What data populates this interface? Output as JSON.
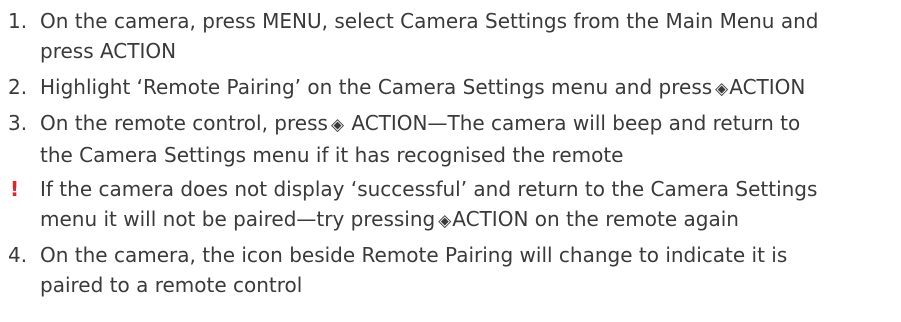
{
  "steps": [
    {
      "marker": "1.",
      "line1": "On the camera, press MENU, select Camera Settings from the Main Menu and",
      "line2": "press ACTION"
    },
    {
      "marker": "2.",
      "line1_pre": "Highlight ‘Remote Pairing’ on the Camera Settings menu and press",
      "line1_post": "ACTION"
    },
    {
      "marker": "3.",
      "line1_pre": "On the remote control, press",
      "line1_post": " ACTION—The camera will beep and return to",
      "line2": "the Camera Settings menu if it has recognised the remote"
    },
    {
      "marker": "!",
      "line1": "If the camera does not display ‘successful’ and return to the Camera Settings",
      "line2_pre": "menu it will not be paired—try pressing",
      "line2_post": "ACTION on the remote again"
    },
    {
      "marker": "4.",
      "line1": "On the camera, the icon beside Remote Pairing will change to indicate it is",
      "line2": "paired to a remote control"
    }
  ],
  "icons": {
    "action_glyph": "◈"
  },
  "colors": {
    "text": "#3a3a3a",
    "warning": "#e5202a"
  }
}
